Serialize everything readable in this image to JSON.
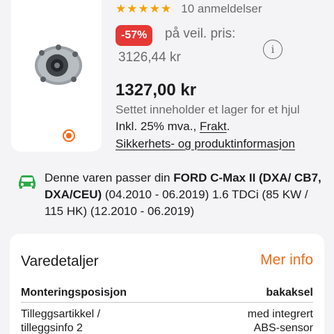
{
  "product": {
    "stars_icon": "star-icon",
    "review_count": "10 anmeldelser",
    "discount": "-57%",
    "ref_label": "på veil. pris:",
    "ref_price": "3126,44 kr",
    "info_glyph": "i",
    "price": "1327,00 kr",
    "kit_note": "Settet inneholder et lager for et hjul",
    "vat_text": "Inkl. 25% mva.,",
    "shipping_link": "Frakt",
    "shipping_suffix": ".",
    "safety_link": "Sikkerhets- og produktinformasjon"
  },
  "compatibility": {
    "icon": "car-check-icon",
    "prefix": "Denne varen passer din ",
    "vehicle": "FORD C-Max II (DXA/ CB7, DXA/CEU)",
    "details": " (04.2010 - 06.2019) 1.6 TDCi (85 KW / 115 HK) (12.2010 - 06.2019)"
  },
  "details": {
    "title": "Varedetaljer",
    "more_link": "Mer info",
    "rows": [
      {
        "label": "Monteringsposisjon",
        "value": "bakaksel"
      },
      {
        "label": "Tilleggsartikkel / tilleggsinfo 2",
        "value": "med integrert ABS-sensor"
      }
    ]
  },
  "colors": {
    "accent": "#ee6c1a",
    "star": "#f5a100",
    "discount_bg": "#e53935",
    "fit_green": "#2eaa4a"
  }
}
